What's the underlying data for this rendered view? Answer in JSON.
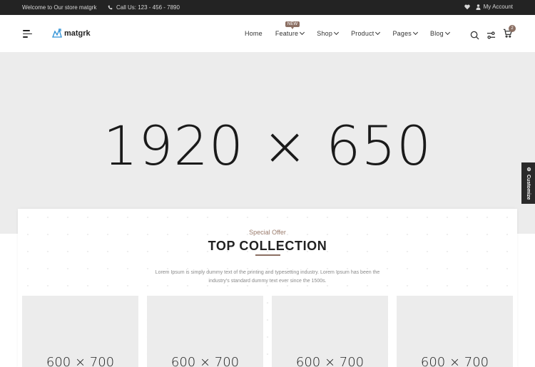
{
  "topbar": {
    "welcome": "Welcome to Our store matgrk",
    "call": "Call Us: 123 - 456 - 7890",
    "account": "My Account",
    "icons": [
      "phone-icon",
      "heart-icon",
      "user-icon"
    ]
  },
  "header": {
    "logo_text": "matgrk",
    "nav": [
      {
        "label": "Home",
        "dropdown": false
      },
      {
        "label": "Feature",
        "dropdown": true,
        "badge": "NEW"
      },
      {
        "label": "Shop",
        "dropdown": true
      },
      {
        "label": "Product",
        "dropdown": true
      },
      {
        "label": "Pages",
        "dropdown": true
      },
      {
        "label": "Blog",
        "dropdown": true
      }
    ],
    "cart_count": "2",
    "icons": [
      "menu-icon",
      "search-icon",
      "settings-icon",
      "cart-icon"
    ]
  },
  "hero": {
    "placeholder": "1920 × 650"
  },
  "customize": {
    "label": "Customize"
  },
  "collection": {
    "kicker": "Special Offer",
    "title": "TOP COLLECTION",
    "description": "Lorem Ipsum is simply dummy text of the printing and typesetting industry. Lorem Ipsum has been the industry's standard dummy text ever since the 1500s.",
    "cards": [
      "600 × 700",
      "600 × 700",
      "600 × 700",
      "600 × 700"
    ]
  },
  "colors": {
    "accent": "#8b6f63",
    "topbar_bg": "#232323",
    "hero_bg": "#ececec"
  }
}
